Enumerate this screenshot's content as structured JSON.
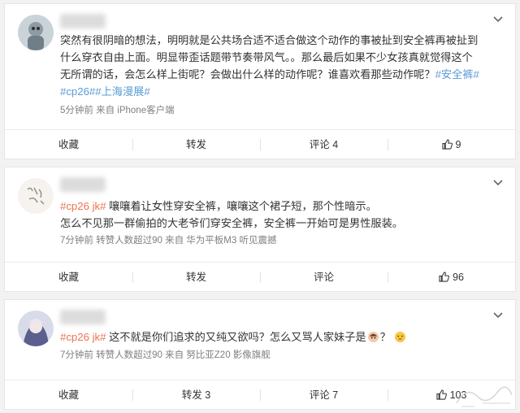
{
  "posts": [
    {
      "text_main": "突然有很阴暗的想法，明明就是公共场合适不适合做这个动作的事被扯到安全裤再被扯到什么穿衣自由上面。明显带歪话题带节奏带风气。。那么最后如果不少女孩真就觉得这个无所谓的话，会怎么样上街呢？会做出什么样的动作呢？谁喜欢看那些动作呢？",
      "topic_1": "#安全裤#",
      "topic_2": "#cp26#",
      "topic_3": "#上海漫展#",
      "meta": "5分钟前  来自 iPhone客户端",
      "actions": {
        "collect": "收藏",
        "repost": "转发",
        "comment": "评论 4",
        "like": "9"
      }
    },
    {
      "tag": "#cp26 jk#",
      "line1": " 嚷嚷着让女性穿安全裤，嚷嚷这个裙子短，那个性暗示。",
      "line2": "怎么不见那一群偷拍的大老爷们穿安全裤，安全裤一开始可是男性服装。",
      "meta": "7分钟前 转赞人数超过90  来自 华为平板M3 听见震撼",
      "actions": {
        "collect": "收藏",
        "repost": "转发",
        "comment": "评论",
        "like": "96"
      }
    },
    {
      "tag": "#cp26 jk#",
      "text_a": " 这不就是你们追求的又纯又欲吗？怎么又骂人家妹子是",
      "text_b": "？",
      "meta": "7分钟前 转赞人数超过90  来自 努比亚Z20 影像旗舰",
      "actions": {
        "collect": "收藏",
        "repost": "转发 3",
        "comment": "评论 7",
        "like": "103"
      }
    }
  ],
  "icons": {
    "menu": "chevron-down-icon",
    "like": "thumbs-up-icon"
  }
}
